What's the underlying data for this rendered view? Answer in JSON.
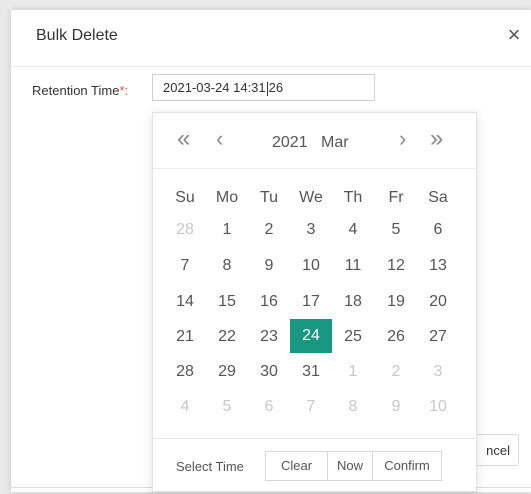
{
  "dialog": {
    "title": "Bulk Delete",
    "close_icon": "×",
    "retention_label": "Retention Time",
    "required_mark": "*:",
    "time_value_before_caret": "2021-03-24 14:31",
    "time_value_after_caret": "26",
    "cancel_label": "ncel"
  },
  "picker": {
    "nav": {
      "prev_year": "«",
      "prev_month": "‹",
      "next_month": "›",
      "next_year": "»"
    },
    "year": "2021",
    "month": "Mar",
    "weekdays": [
      "Su",
      "Mo",
      "Tu",
      "We",
      "Th",
      "Fr",
      "Sa"
    ],
    "weeks": [
      [
        "28",
        "1",
        "2",
        "3",
        "4",
        "5",
        "6"
      ],
      [
        "7",
        "8",
        "9",
        "10",
        "11",
        "12",
        "13"
      ],
      [
        "14",
        "15",
        "16",
        "17",
        "18",
        "19",
        "20"
      ],
      [
        "21",
        "22",
        "23",
        "24",
        "25",
        "26",
        "27"
      ],
      [
        "28",
        "29",
        "30",
        "31",
        "1",
        "2",
        "3"
      ],
      [
        "4",
        "5",
        "6",
        "7",
        "8",
        "9",
        "10"
      ]
    ],
    "selected_day": "24",
    "select_time_label": "Select Time",
    "buttons": {
      "clear": "Clear",
      "now": "Now",
      "confirm": "Confirm"
    },
    "accent_color": "#169882"
  }
}
